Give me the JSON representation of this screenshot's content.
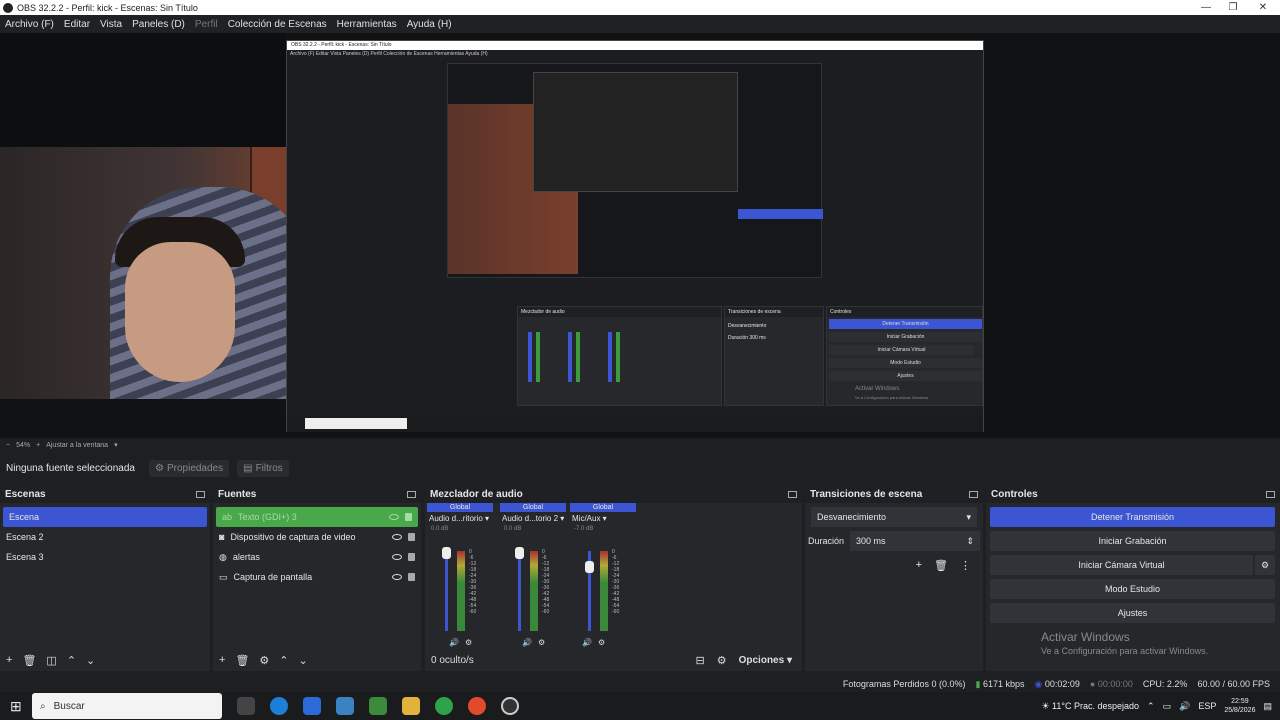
{
  "window": {
    "title": "OBS 32.2.2 - Perfil: kick - Escenas: Sin Título",
    "min": "—",
    "max": "❐",
    "close": "✕"
  },
  "menu": [
    "Archivo (F)",
    "Editar",
    "Vista",
    "Paneles (D)",
    "Perfil",
    "Colección de Escenas",
    "Herramientas",
    "Ayuda (H)"
  ],
  "zoom": {
    "value": "54%",
    "fit_label": "Ajustar a la ventana"
  },
  "source_toolbar": {
    "none_selected": "Ninguna fuente seleccionada",
    "properties": "Propiedades",
    "filters": "Filtros"
  },
  "scenes": {
    "title": "Escenas",
    "items": [
      "Escena",
      "Escena 2",
      "Escena 3"
    ],
    "selected": 0
  },
  "sources": {
    "title": "Fuentes",
    "items": [
      {
        "name": "Texto (GDI+) 3",
        "icon": "text-icon",
        "glyph": "ab"
      },
      {
        "name": "Dispositivo de captura de video",
        "icon": "camera-icon",
        "glyph": "◙"
      },
      {
        "name": "alertas",
        "icon": "browser-icon",
        "glyph": "◍"
      },
      {
        "name": "Captura de pantalla",
        "icon": "monitor-icon",
        "glyph": "▭"
      }
    ]
  },
  "mixer": {
    "title": "Mezclador de audio",
    "global": "Global",
    "channels": [
      {
        "name": "Audio d...ritorio",
        "db": "0.0 dB"
      },
      {
        "name": "Audio d...torio 2",
        "db": "0.0 dB"
      },
      {
        "name": "Mic/Aux",
        "db": "-7.0 dB"
      }
    ],
    "scale": [
      "0",
      "-6",
      "-12",
      "-18",
      "-24",
      "-30",
      "-36",
      "-42",
      "-48",
      "-54",
      "-60"
    ],
    "hidden": "0 oculto/s",
    "options": "Opciones"
  },
  "transitions": {
    "title": "Transiciones de escena",
    "selected": "Desvanecimiento",
    "duration_label": "Duración",
    "duration": "300 ms"
  },
  "controls": {
    "title": "Controles",
    "stop_stream": "Detener Transmisión",
    "start_record": "Iniciar Grabación",
    "start_vcam": "Iniciar Cámara Virtual",
    "studio_mode": "Modo Estudio",
    "settings": "Ajustes"
  },
  "activation": {
    "title": "Activar Windows",
    "subtitle": "Ve a Configuración para activar Windows."
  },
  "status": {
    "dropped": "Fotogramas Perdidos 0 (0.0%)",
    "bitrate": "6171 kbps",
    "stream_time": "00:02:09",
    "rec_time": "00:00:00",
    "cpu": "CPU: 2.2%",
    "fps": "60.00 / 60.00 FPS"
  },
  "taskbar": {
    "search": "Buscar",
    "weather": "11°C  Prac. despejado",
    "lang": "ESP",
    "time": "22:59",
    "date": "25/8/2026"
  },
  "nested": {
    "title": "OBS 32.2.2 - Perfil: kick - Escenas: Sin Título",
    "menu": "Archivo (F)   Editar   Vista   Paneles (D)   Perfil   Colección de Escenas   Herramientas   Ayuda (H)",
    "mixer": "Mezclador de audio",
    "transitions": "Transiciones de escena",
    "controls": "Controles",
    "btns": [
      "Detener Transmisión",
      "Iniciar Grabación",
      "Iniciar Cámara Virtual",
      "Modo Estudio",
      "Ajustes"
    ],
    "fade": "Desvanecimiento",
    "duration": "Duración",
    "duration_val": "300 ms",
    "activation": "Activar Windows",
    "activation_sub": "Ve a Configuración para activar Windows"
  },
  "colors": {
    "accent": "#3c55d3",
    "green": "#49a84a",
    "bg": "#1e1f22"
  }
}
